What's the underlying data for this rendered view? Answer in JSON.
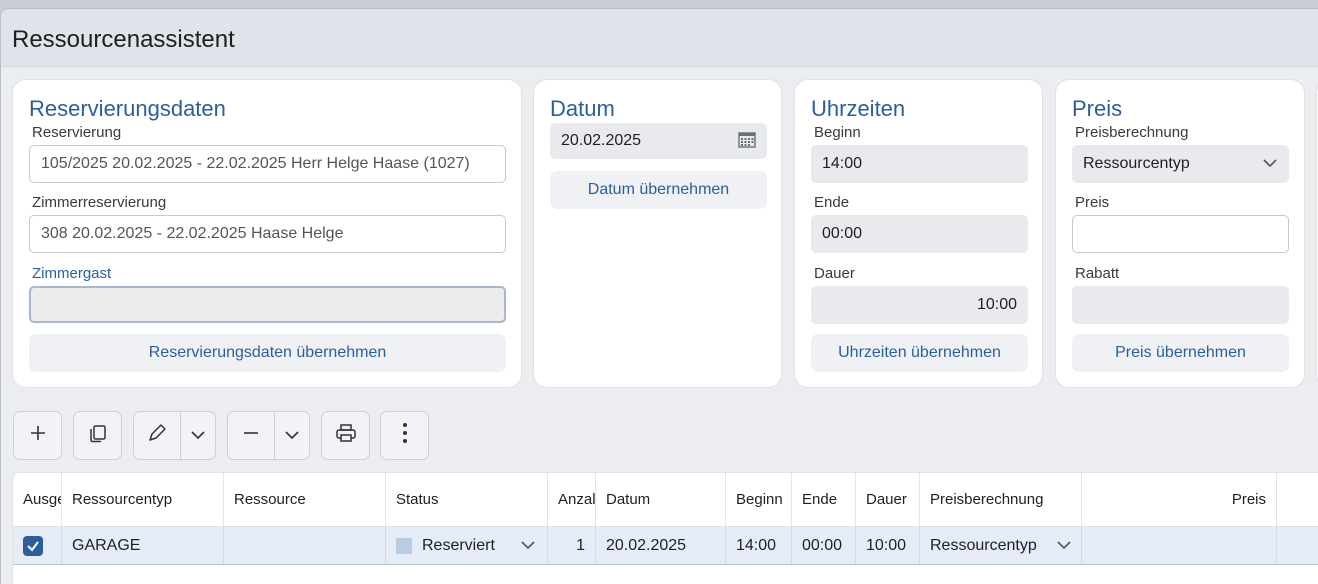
{
  "window": {
    "title": "Ressourcenassistent"
  },
  "reservation_card": {
    "heading": "Reservierungsdaten",
    "reservation_label": "Reservierung",
    "reservation_value": "105/2025 20.02.2025 - 22.02.2025  Herr Helge Haase (1027)",
    "room_res_label": "Zimmerreservierung",
    "room_res_value": "308  20.02.2025 - 22.02.2025  Haase Helge",
    "guest_label": "Zimmergast",
    "guest_value": "",
    "apply_label": "Reservierungsdaten übernehmen"
  },
  "date_card": {
    "heading": "Datum",
    "date_value": "20.02.2025",
    "apply_label": "Datum übernehmen"
  },
  "time_card": {
    "heading": "Uhrzeiten",
    "begin_label": "Beginn",
    "begin_value": "14:00",
    "end_label": "Ende",
    "end_value": "00:00",
    "duration_label": "Dauer",
    "duration_value": "10:00",
    "apply_label": "Uhrzeiten übernehmen"
  },
  "price_card": {
    "heading": "Preis",
    "calc_label": "Preisberechnung",
    "calc_value": "Ressourcentyp",
    "price_label": "Preis",
    "price_value": "",
    "discount_label": "Rabatt",
    "discount_value": "",
    "apply_label": "Preis übernehmen"
  },
  "toolbar": {
    "icons": [
      "plus-icon",
      "copy-icon",
      "pencil-icon",
      "chevron-down-icon",
      "minus-icon",
      "chevron-down-icon",
      "printer-icon",
      "more-vertical-icon"
    ]
  },
  "table": {
    "columns": [
      "Ausge",
      "Ressourcentyp",
      "Ressource",
      "Status",
      "Anzal",
      "Datum",
      "Beginn",
      "Ende",
      "Dauer",
      "Preisberechnung",
      "Preis"
    ],
    "rows": [
      {
        "checked": true,
        "type": "GARAGE",
        "resource": "",
        "status": "Reserviert",
        "count": "1",
        "date": "20.02.2025",
        "begin": "14:00",
        "end": "00:00",
        "duration": "10:00",
        "calc": "Ressourcentyp",
        "price": ""
      }
    ]
  },
  "colors": {
    "accent": "#2b5f9c",
    "status_reserved": "#b7cde3",
    "selected_row": "#e5ecf8"
  }
}
